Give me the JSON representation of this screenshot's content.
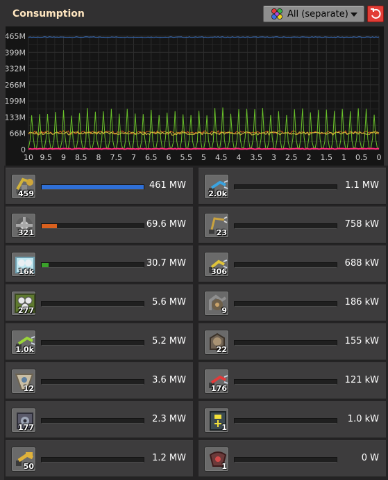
{
  "header": {
    "title": "Consumption",
    "dropdown_label": "All (separate)",
    "dropdown_icon": "multicolor-circles-icon",
    "reset_icon": "reset-icon"
  },
  "chart_data": {
    "type": "line",
    "title": "",
    "xlabel": "",
    "ylabel": "",
    "y_ticks": [
      "0",
      "66M",
      "133M",
      "199M",
      "266M",
      "332M",
      "399M",
      "465M"
    ],
    "ylim": [
      0,
      465
    ],
    "x_ticks": [
      "10",
      "9.5",
      "9",
      "8.5",
      "8",
      "7.5",
      "7",
      "6.5",
      "6",
      "5.5",
      "5",
      "4.5",
      "4",
      "3.5",
      "3",
      "2.5",
      "2",
      "1.5",
      "1",
      "0.5",
      "0"
    ],
    "xlim": [
      10,
      0
    ],
    "grid": true,
    "series": [
      {
        "color": "#3a74c9",
        "approx_level": 461,
        "pattern": "flat"
      },
      {
        "color": "#d9601e",
        "approx_level": 70,
        "pattern": "noisy"
      },
      {
        "color": "#69c22a",
        "approx_level": 31,
        "pattern": "spiky",
        "spike_peak": 170
      },
      {
        "color": "#d4c43a",
        "approx_level": 66,
        "pattern": "noisy"
      },
      {
        "color": "#ff2a7a",
        "approx_level": 3,
        "pattern": "flat"
      }
    ]
  },
  "entries": [
    {
      "name": "pumpjack-icon",
      "count": "459",
      "value": "461 MW",
      "bar": 1.0,
      "color": "#2f6fd6"
    },
    {
      "name": "fast-inserter-icon",
      "count": "2.0k",
      "value": "1.1 MW",
      "bar": 0,
      "color": "#2f6fd6"
    },
    {
      "name": "electric-mining-drill-icon",
      "count": "321",
      "value": "69.6 MW",
      "bar": 0.15,
      "color": "#d9601e"
    },
    {
      "name": "long-handed-inserter-icon",
      "count": "23",
      "value": "758 kW",
      "bar": 0,
      "color": "#2f6fd6"
    },
    {
      "name": "chemical-plant-icon",
      "count": "16k",
      "value": "30.7 MW",
      "bar": 0.066,
      "color": "#3aa12a"
    },
    {
      "name": "inserter-icon",
      "count": "306",
      "value": "688 kW",
      "bar": 0,
      "color": "#2f6fd6"
    },
    {
      "name": "assembling-machine-icon",
      "count": "277",
      "value": "5.6 MW",
      "bar": 0,
      "color": "#2f6fd6"
    },
    {
      "name": "oil-refinery-icon",
      "count": "9",
      "value": "186 kW",
      "bar": 0,
      "color": "#2f6fd6"
    },
    {
      "name": "filter-inserter-icon",
      "count": "1.0k",
      "value": "5.2 MW",
      "bar": 0,
      "color": "#2f6fd6"
    },
    {
      "name": "centrifuge-icon",
      "count": "22",
      "value": "155 kW",
      "bar": 0,
      "color": "#2f6fd6"
    },
    {
      "name": "lab-icon",
      "count": "12",
      "value": "3.6 MW",
      "bar": 0,
      "color": "#2f6fd6"
    },
    {
      "name": "stack-inserter-icon",
      "count": "176",
      "value": "121 kW",
      "bar": 0,
      "color": "#2f6fd6"
    },
    {
      "name": "beacon-icon",
      "count": "177",
      "value": "2.3 MW",
      "bar": 0,
      "color": "#2f6fd6"
    },
    {
      "name": "accumulator-icon",
      "count": "1",
      "value": "1.0 kW",
      "bar": 0,
      "color": "#2f6fd6"
    },
    {
      "name": "burner-inserter-icon",
      "count": "50",
      "value": "1.2 MW",
      "bar": 0,
      "color": "#2f6fd6"
    },
    {
      "name": "radar-icon",
      "count": "1",
      "value": "0 W",
      "bar": 0,
      "color": "#2f6fd6"
    }
  ]
}
